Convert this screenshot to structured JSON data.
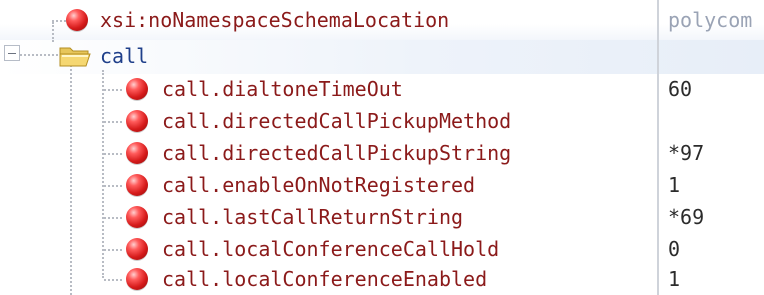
{
  "tree": {
    "root_attr": {
      "label": "xsi:noNamespaceSchemaLocation",
      "value": "polycom"
    },
    "folder": {
      "label": "call",
      "icon": "folder-open-icon"
    },
    "items": [
      {
        "label": "call.dialtoneTimeOut",
        "value": "60"
      },
      {
        "label": "call.directedCallPickupMethod",
        "value": ""
      },
      {
        "label": "call.directedCallPickupString",
        "value": "*97"
      },
      {
        "label": "call.enableOnNotRegistered",
        "value": "1"
      },
      {
        "label": "call.lastCallReturnString",
        "value": "*69"
      },
      {
        "label": "call.localConferenceCallHold",
        "value": "0"
      },
      {
        "label": "call.localConferenceEnabled",
        "value": "1"
      }
    ]
  },
  "colors": {
    "attribute_text": "#8b1a1a",
    "folder_text": "#1f3f8a",
    "value_text": "#2b2b2b",
    "attribute_icon": "#d61b1b"
  },
  "icons": {
    "attribute": "red-ball-attribute-icon",
    "folder": "folder-open-icon",
    "expander": "collapse-minus-icon"
  }
}
